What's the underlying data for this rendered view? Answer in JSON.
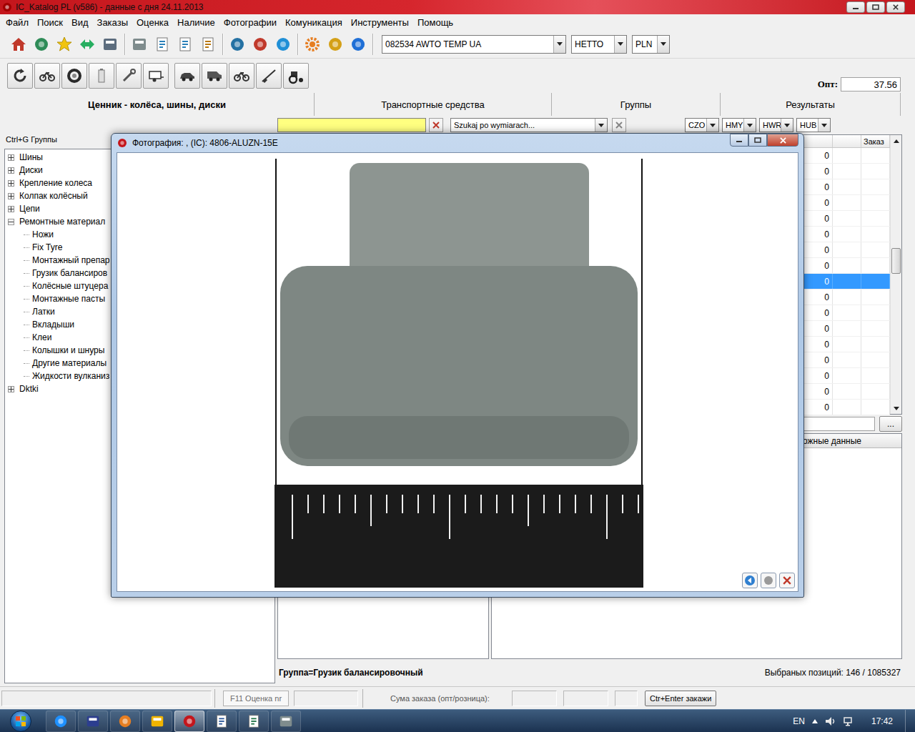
{
  "window": {
    "title": "IC_Katalog PL (v586) - данные с дня 24.11.2013"
  },
  "menu": [
    "Файл",
    "Поиск",
    "Вид",
    "Заказы",
    "Оценка",
    "Наличие",
    "Фотографии",
    "Комуникация",
    "Инструменты",
    "Помощь"
  ],
  "selectors": {
    "client": "082534 AWTO TEMP UA",
    "price_type": "НЕТТО",
    "currency": "PLN"
  },
  "opt": {
    "label": "Опт:",
    "value": "37.56"
  },
  "catalog_title": "Ценник - колёса, шины, диски",
  "tabs": [
    {
      "label": "Транспортные средства",
      "selected": false
    },
    {
      "label": "Группы",
      "selected": false
    },
    {
      "label": "Результаты",
      "selected": false
    }
  ],
  "filter": {
    "value": "",
    "size_search": "Szukaj po wymiarach...",
    "codes": [
      "CZO",
      "HMY",
      "HWR",
      "HUB"
    ]
  },
  "sidebar": {
    "label": "Ctrl+G Группы",
    "items": [
      {
        "label": "Шины",
        "depth": 0,
        "has_children": true,
        "expanded": false
      },
      {
        "label": "Диски",
        "depth": 0,
        "has_children": true,
        "expanded": false
      },
      {
        "label": "Крепление колеса",
        "depth": 0,
        "has_children": true,
        "expanded": false
      },
      {
        "label": "Колпак колёсный",
        "depth": 0,
        "has_children": true,
        "expanded": false
      },
      {
        "label": "Цепи",
        "depth": 0,
        "has_children": true,
        "expanded": false
      },
      {
        "label": "Ремонтные материал",
        "depth": 0,
        "has_children": true,
        "expanded": true
      },
      {
        "label": "Ножи",
        "depth": 1,
        "has_children": false,
        "expanded": false
      },
      {
        "label": "Fix Tyre",
        "depth": 1,
        "has_children": false,
        "expanded": false
      },
      {
        "label": "Монтажный препар",
        "depth": 1,
        "has_children": false,
        "expanded": false
      },
      {
        "label": "Грузик балансиров",
        "depth": 1,
        "has_children": false,
        "expanded": false
      },
      {
        "label": "Колёсные штуцера",
        "depth": 1,
        "has_children": false,
        "expanded": false
      },
      {
        "label": "Монтажные пасты",
        "depth": 1,
        "has_children": false,
        "expanded": false
      },
      {
        "label": "Латки",
        "depth": 1,
        "has_children": false,
        "expanded": false
      },
      {
        "label": "Вкладыши",
        "depth": 1,
        "has_children": false,
        "expanded": false
      },
      {
        "label": "Клеи",
        "depth": 1,
        "has_children": false,
        "expanded": false
      },
      {
        "label": "Колышки и шнуры",
        "depth": 1,
        "has_children": false,
        "expanded": false
      },
      {
        "label": "Другие материалы",
        "depth": 1,
        "has_children": false,
        "expanded": false
      },
      {
        "label": "Жидкости вулканиз",
        "depth": 1,
        "has_children": false,
        "expanded": false
      },
      {
        "label": "Dktki",
        "depth": 0,
        "has_children": true,
        "expanded": false
      }
    ]
  },
  "table": {
    "order_header": "Заказ",
    "scroll_position": 0.44,
    "rows": [
      {
        "qty": "0",
        "selected": false
      },
      {
        "qty": "0",
        "selected": false
      },
      {
        "qty": "0",
        "selected": false
      },
      {
        "qty": "0",
        "selected": false
      },
      {
        "qty": "0",
        "selected": false
      },
      {
        "qty": "0",
        "selected": false
      },
      {
        "qty": "0",
        "selected": false
      },
      {
        "qty": "0",
        "selected": false
      },
      {
        "qty": "0",
        "selected": true
      },
      {
        "qty": "0",
        "selected": false
      },
      {
        "qty": "0",
        "selected": false
      },
      {
        "qty": "0",
        "selected": false
      },
      {
        "qty": "0",
        "selected": false
      },
      {
        "qty": "0",
        "selected": false
      },
      {
        "qty": "0",
        "selected": false
      },
      {
        "qty": "0",
        "selected": false
      },
      {
        "qty": "0",
        "selected": false
      }
    ]
  },
  "detail_button": "...",
  "details_tab": "ложные данные",
  "group_line": "Группа=Грузик балансировочный",
  "count_line": "Выбраных позиций: 146 / 1085327",
  "status_bar": {
    "estimate_button": "F11 Оценка nr",
    "sum_label": "Сума заказа (опт/розница):",
    "order_button": "Ctr+Enter закажи"
  },
  "dialog": {
    "title": "Фотография: , (IC): 4806-ALUZN-15E"
  },
  "taskbar": {
    "language": "EN",
    "time": "17:42"
  }
}
